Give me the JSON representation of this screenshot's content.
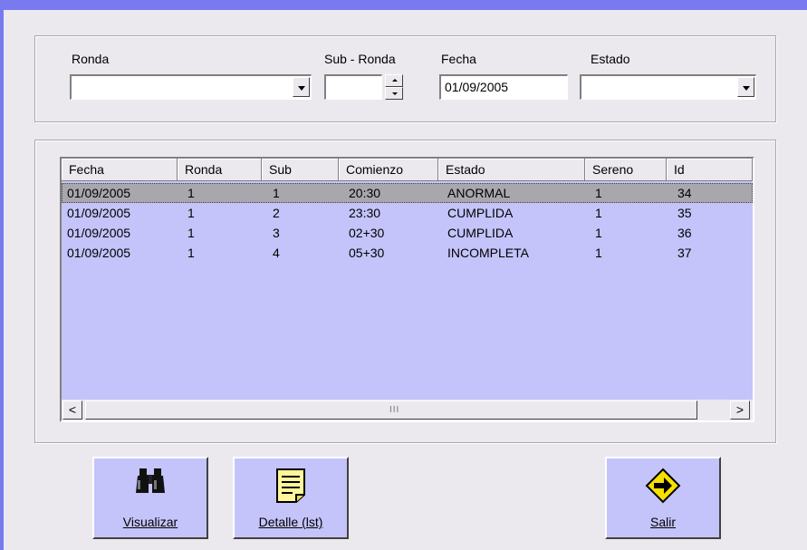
{
  "filters": {
    "ronda": {
      "label": "Ronda",
      "value": ""
    },
    "sub_ronda": {
      "label": "Sub - Ronda",
      "value": ""
    },
    "fecha": {
      "label": "Fecha",
      "value": "01/09/2005"
    },
    "estado": {
      "label": "Estado",
      "value": ""
    }
  },
  "table": {
    "columns": [
      "Fecha",
      "Ronda",
      "Sub",
      "Comienzo",
      "Estado",
      "Sereno",
      "Id"
    ],
    "rows": [
      [
        "01/09/2005",
        "1",
        "1",
        "20:30",
        "ANORMAL",
        "1",
        "34"
      ],
      [
        "01/09/2005",
        "1",
        "2",
        "23:30",
        "CUMPLIDA",
        "1",
        "35"
      ],
      [
        "01/09/2005",
        "1",
        "3",
        "02+30",
        "CUMPLIDA",
        "1",
        "36"
      ],
      [
        "01/09/2005",
        "1",
        "4",
        "05+30",
        "INCOMPLETA",
        "1",
        "37"
      ]
    ],
    "selected_row": 0,
    "scroll_left": "<",
    "scroll_right": ">",
    "scroll_grip": "III"
  },
  "buttons": {
    "visualizar": {
      "label": "Visualizar",
      "icon": "binoculars-icon"
    },
    "detalle": {
      "label": "Detalle (lst)",
      "icon": "notepad-icon"
    },
    "salir": {
      "label": "Salir",
      "icon": "exit-arrow-sign-icon"
    }
  },
  "colors": {
    "window_frame": "#7a7af0",
    "list_background": "#c4c4fb",
    "selected_row": "#a7a7ad",
    "face": "#ebe9ed"
  }
}
